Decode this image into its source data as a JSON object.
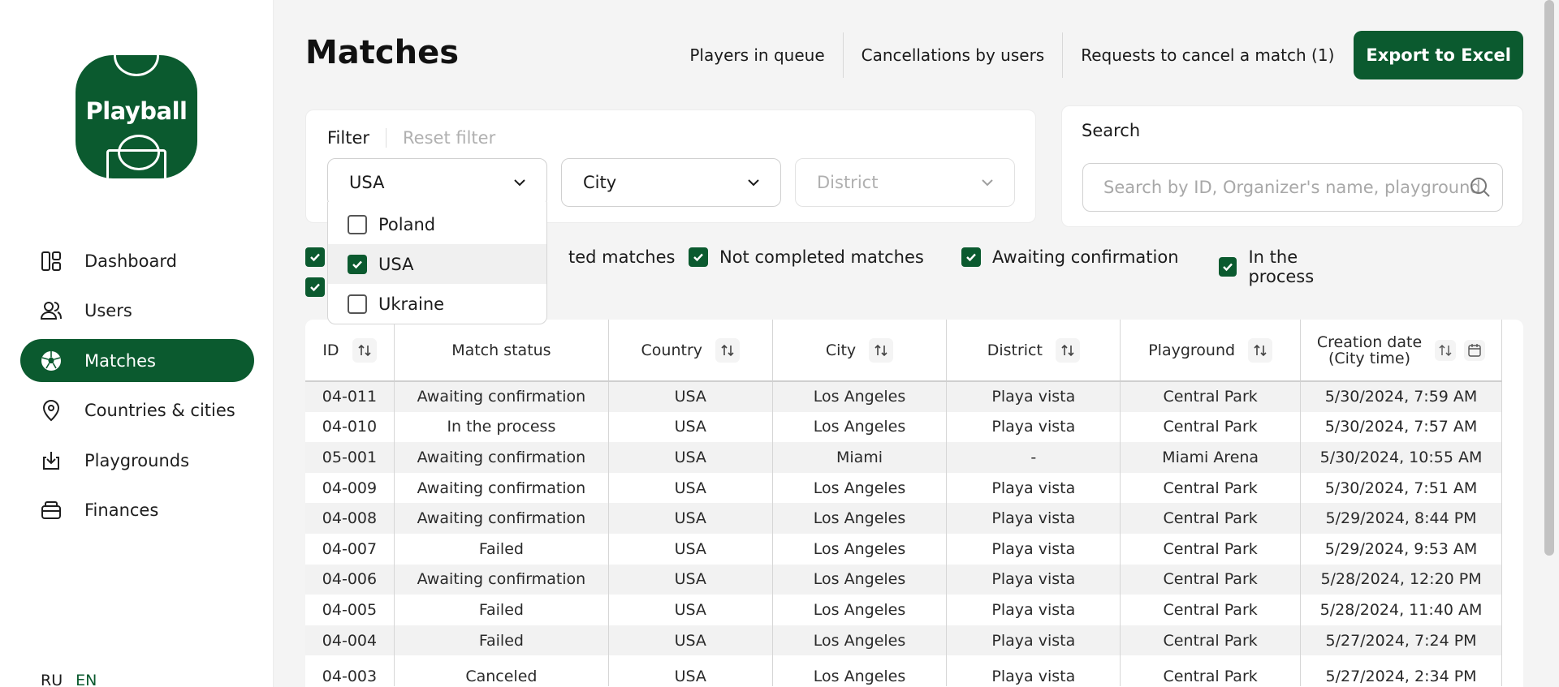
{
  "app": {
    "logo_text": "Playball"
  },
  "sidebar": {
    "items": [
      {
        "label": "Dashboard",
        "icon": "dashboard-icon"
      },
      {
        "label": "Users",
        "icon": "users-icon"
      },
      {
        "label": "Matches",
        "icon": "soccer-ball-icon",
        "active": true
      },
      {
        "label": "Countries & cities",
        "icon": "location-pin-icon"
      },
      {
        "label": "Playgrounds",
        "icon": "download-tray-icon"
      },
      {
        "label": "Finances",
        "icon": "wallet-icon"
      }
    ],
    "lang": {
      "ru": "RU",
      "en": "EN",
      "active": "EN"
    }
  },
  "header": {
    "title": "Matches",
    "links": [
      "Players in queue",
      "Cancellations by users",
      "Requests to cancel a match (1)"
    ],
    "export_label": "Export to Excel"
  },
  "filter": {
    "label": "Filter",
    "reset_label": "Reset filter",
    "country": "USA",
    "city": "City",
    "district": "District",
    "dropdown_options": [
      {
        "label": "Poland",
        "checked": false
      },
      {
        "label": "USA",
        "checked": true
      },
      {
        "label": "Ukraine",
        "checked": false
      }
    ]
  },
  "search": {
    "label": "Search",
    "placeholder": "Search by ID, Organizer's name, playground"
  },
  "status_checkboxes": [
    {
      "label": "Completed matches",
      "visible_text": "ted matches",
      "checked": true
    },
    {
      "label": "Not completed matches",
      "checked": true
    },
    {
      "label": "Awaiting confirmation",
      "checked": true
    },
    {
      "label": "In the process",
      "checked": true
    }
  ],
  "table": {
    "columns": [
      "ID",
      "Match status",
      "Country",
      "City",
      "District",
      "Playground",
      "Creation date (City time)"
    ],
    "date_header_line1": "Creation date",
    "date_header_line2": "(City time)",
    "rows": [
      [
        "04-011",
        "Awaiting confirmation",
        "USA",
        "Los Angeles",
        "Playa vista",
        "Central Park",
        "5/30/2024, 7:59 AM"
      ],
      [
        "04-010",
        "In the process",
        "USA",
        "Los Angeles",
        "Playa vista",
        "Central Park",
        "5/30/2024, 7:57 AM"
      ],
      [
        "05-001",
        "Awaiting confirmation",
        "USA",
        "Miami",
        "-",
        "Miami Arena",
        "5/30/2024, 10:55 AM"
      ],
      [
        "04-009",
        "Awaiting confirmation",
        "USA",
        "Los Angeles",
        "Playa vista",
        "Central Park",
        "5/30/2024, 7:51 AM"
      ],
      [
        "04-008",
        "Awaiting confirmation",
        "USA",
        "Los Angeles",
        "Playa vista",
        "Central Park",
        "5/29/2024, 8:44 PM"
      ],
      [
        "04-007",
        "Failed",
        "USA",
        "Los Angeles",
        "Playa vista",
        "Central Park",
        "5/29/2024, 9:53 AM"
      ],
      [
        "04-006",
        "Awaiting confirmation",
        "USA",
        "Los Angeles",
        "Playa vista",
        "Central Park",
        "5/28/2024, 12:20 PM"
      ],
      [
        "04-005",
        "Failed",
        "USA",
        "Los Angeles",
        "Playa vista",
        "Central Park",
        "5/28/2024, 11:40 AM"
      ],
      [
        "04-004",
        "Failed",
        "USA",
        "Los Angeles",
        "Playa vista",
        "Central Park",
        "5/27/2024, 7:24 PM"
      ],
      [
        "04-003",
        "Canceled",
        "USA",
        "Los Angeles",
        "Playa vista",
        "Central Park",
        "5/27/2024, 2:34 PM"
      ]
    ]
  },
  "colors": {
    "brand": "#0b5a2f",
    "background": "#f4f4f4",
    "row_alt": "#f2f2f2"
  }
}
